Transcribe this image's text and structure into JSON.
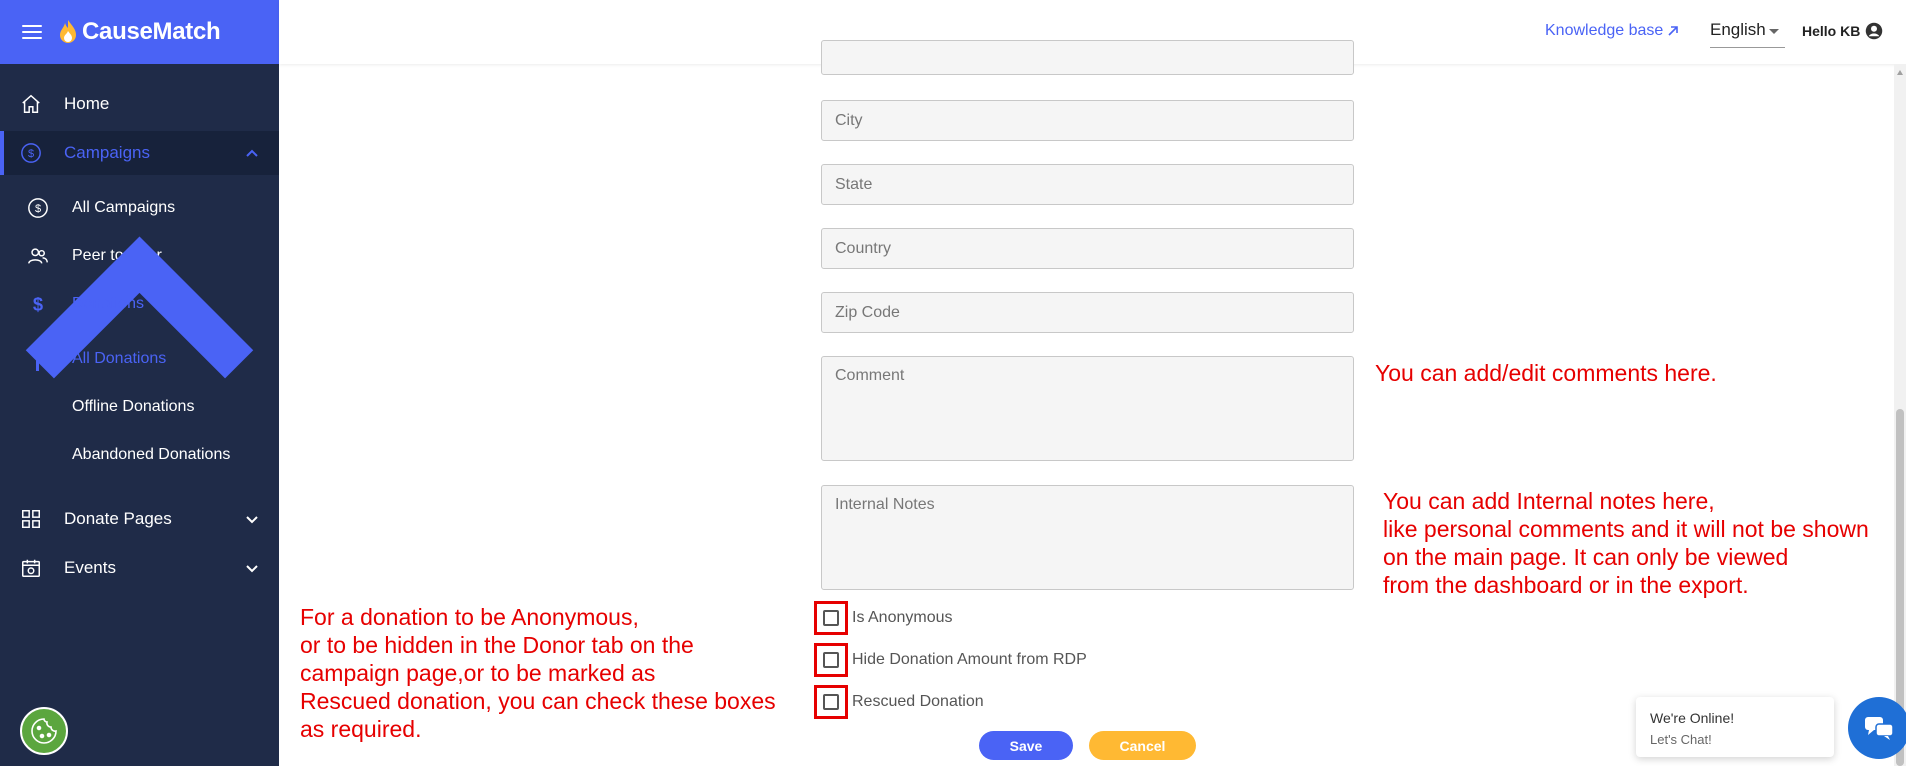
{
  "app": {
    "name": "CauseMatch"
  },
  "sidebar": {
    "items": [
      {
        "label": "Home",
        "icon": "home-icon"
      },
      {
        "label": "Campaigns",
        "icon": "dollar-circle-icon"
      },
      {
        "label": "Donate Pages",
        "icon": "grid-icon"
      },
      {
        "label": "Events",
        "icon": "calendar-icon"
      }
    ],
    "campaign_children": [
      {
        "label": "All Campaigns",
        "icon": "dollar-circle-icon"
      },
      {
        "label": "Peer to Peer",
        "icon": "people-icon"
      },
      {
        "label": "Donations",
        "icon": "dollar-icon"
      }
    ],
    "donation_children": [
      {
        "label": "All Donations"
      },
      {
        "label": "Offline Donations"
      },
      {
        "label": "Abandoned Donations"
      }
    ]
  },
  "header": {
    "knowledge_base": "Knowledge base",
    "language": "English",
    "greeting": "Hello KB"
  },
  "form": {
    "city_placeholder": "City",
    "state_placeholder": "State",
    "country_placeholder": "Country",
    "zip_placeholder": "Zip Code",
    "comment_placeholder": "Comment",
    "internal_notes_placeholder": "Internal Notes",
    "checkboxes": [
      {
        "label": "Is Anonymous",
        "checked": false
      },
      {
        "label": "Hide Donation Amount from RDP",
        "checked": false
      },
      {
        "label": "Rescued Donation",
        "checked": false
      }
    ],
    "save_label": "Save",
    "cancel_label": "Cancel"
  },
  "annotations": {
    "comment_note": "You can add/edit comments here.",
    "internal_note": "You can add Internal notes here,\nlike personal comments and it will not be shown\non the main page. It can only be viewed\nfrom the dashboard or in the export.",
    "checkbox_note": "For a donation to be Anonymous,\nor to be hidden in the Donor tab on the\ncampaign page,or to be marked as\nRescued donation, you can check these boxes\nas required."
  },
  "chat": {
    "title": "We're Online!",
    "subtitle": "Let's Chat!"
  },
  "colors": {
    "brand": "#4a63f5",
    "sidebar": "#1f2b48",
    "annotation": "#e60000",
    "cancel": "#ffb933"
  }
}
